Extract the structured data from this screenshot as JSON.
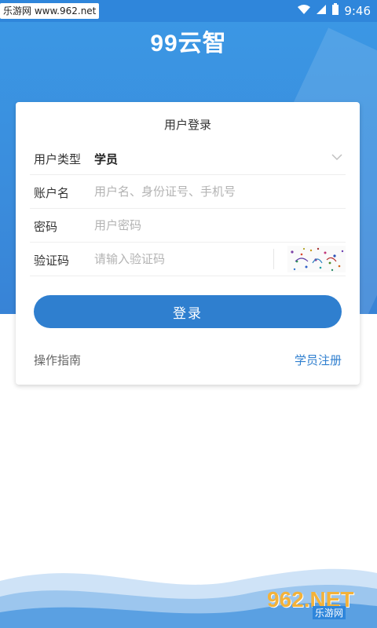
{
  "status_bar": {
    "watermark": "乐游网 www.962.net",
    "time": "9:46"
  },
  "header": {
    "logo_text": "99云智"
  },
  "login_card": {
    "title": "用户登录",
    "user_type_label": "用户类型",
    "user_type_value": "学员",
    "account_label": "账户名",
    "account_placeholder": "用户名、身份证号、手机号",
    "password_label": "密码",
    "password_placeholder": "用户密码",
    "captcha_label": "验证码",
    "captcha_placeholder": "请输入验证码",
    "login_button": "登录",
    "guide_link": "操作指南",
    "register_link": "学员注册"
  },
  "watermark_bottom": {
    "number": "962.NET",
    "subtitle": "乐游网"
  },
  "colors": {
    "primary": "#2f7fcf",
    "header": "#3b97e4"
  }
}
